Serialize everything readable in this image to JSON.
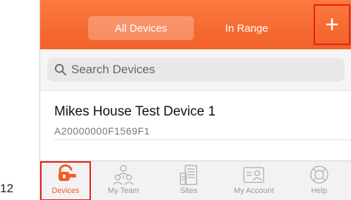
{
  "step_number": "12",
  "header": {
    "segments": [
      {
        "label": "All Devices",
        "active": true
      },
      {
        "label": "In Range",
        "active": false
      }
    ],
    "add_button": "+"
  },
  "search": {
    "placeholder": "Search Devices",
    "value": ""
  },
  "devices": [
    {
      "name": "Mikes House Test Device 1",
      "id": "A20000000F1569F1"
    }
  ],
  "tabbar": {
    "tabs": [
      {
        "label": "Devices",
        "icon": "lock-icon",
        "active": true
      },
      {
        "label": "My Team",
        "icon": "team-icon",
        "active": false
      },
      {
        "label": "Sites",
        "icon": "building-icon",
        "active": false
      },
      {
        "label": "My Account",
        "icon": "account-card-icon",
        "active": false
      },
      {
        "label": "Help",
        "icon": "lifebuoy-icon",
        "active": false
      }
    ]
  },
  "colors": {
    "brand_orange": "#f26a2e",
    "highlight_red": "#e81e18",
    "tab_inactive": "#9a9a9a"
  }
}
